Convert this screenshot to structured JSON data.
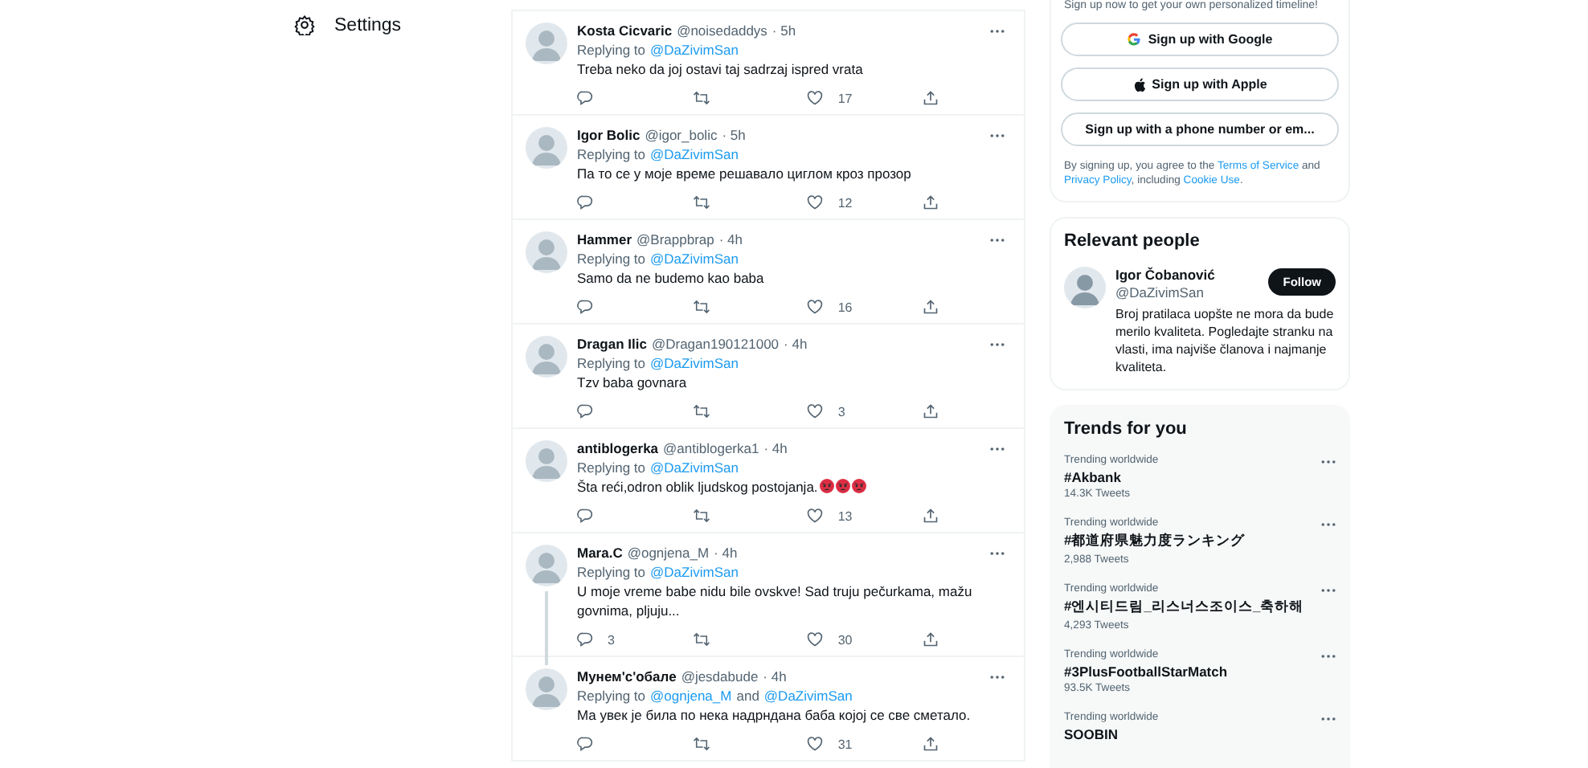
{
  "nav": {
    "settings_label": "Settings"
  },
  "tweets": [
    {
      "name": "Kosta Cicvaric",
      "handle": "@noisedaddys",
      "time": "· 5h",
      "replying_label": "Replying to",
      "replying_to": [
        "@DaZivimSan"
      ],
      "text": "Treba neko da joj ostavi taj sadrzaj ispred vrata",
      "like_count": "17",
      "thread": false
    },
    {
      "name": "Igor Bolic",
      "handle": "@igor_bolic",
      "time": "· 5h",
      "replying_label": "Replying to",
      "replying_to": [
        "@DaZivimSan"
      ],
      "text": "Па то се у моје време решавало циглом кроз прозор",
      "like_count": "12",
      "thread": false
    },
    {
      "name": "Hammer",
      "handle": "@Brappbrap",
      "time": "· 4h",
      "replying_label": "Replying to",
      "replying_to": [
        "@DaZivimSan"
      ],
      "text": "Samo da ne budemo kao baba",
      "like_count": "16",
      "thread": false
    },
    {
      "name": "Dragan Ilic",
      "handle": "@Dragan190121000",
      "time": "· 4h",
      "replying_label": "Replying to",
      "replying_to": [
        "@DaZivimSan"
      ],
      "text": "Tzv baba govnara",
      "like_count": "3",
      "thread": false
    },
    {
      "name": "antiblogerka",
      "handle": "@antiblogerka1",
      "time": "· 4h",
      "replying_label": "Replying to",
      "replying_to": [
        "@DaZivimSan"
      ],
      "text": "Šta reći,odron oblik ljudskog postojanja.",
      "angry_emojis": true,
      "like_count": "13",
      "thread": false
    },
    {
      "name": "Mara.C",
      "handle": "@ognjena_M",
      "time": "· 4h",
      "replying_label": "Replying to",
      "replying_to": [
        "@DaZivimSan"
      ],
      "text": "U moje vreme babe nidu bile ovskve! Sad truju pečurkama, mažu govnima, pljuju...",
      "reply_count": "3",
      "like_count": "30",
      "thread": true
    },
    {
      "name": "Мунем'с'обале",
      "handle": "@jesdabude",
      "time": "· 4h",
      "replying_label": "Replying to",
      "replying_to": [
        "@ognjena_M",
        "@DaZivimSan"
      ],
      "joiner": "and",
      "text": "Ма увек је била по нека надрндана баба којој се све сметало.",
      "like_count": "31",
      "thread": false
    }
  ],
  "signup": {
    "intro": "Sign up now to get your own personalized timeline!",
    "buttons": [
      {
        "kind": "google",
        "label": "Sign up with Google"
      },
      {
        "kind": "apple",
        "label": "Sign up with Apple"
      },
      {
        "kind": "plain",
        "label": "Sign up with a phone number or em..."
      }
    ],
    "terms": {
      "before": "By signing up, you agree to the",
      "tos": "Terms of Service",
      "and": "and",
      "privacy": "Privacy Policy",
      "including": ", including",
      "cookie": "Cookie Use",
      "end": "."
    }
  },
  "relevant": {
    "title": "Relevant people",
    "person": {
      "name": "Igor Čobanović",
      "handle": "@DaZivimSan",
      "bio": "Broj pratilaca uopšte ne mora da bude merilo kvaliteta. Pogledajte stranku na vlasti, ima najviše članova i najmanje kvaliteta.",
      "follow": "Follow"
    }
  },
  "trends": {
    "title": "Trends for you",
    "items": [
      {
        "context": "Trending worldwide",
        "topic": "#Akbank",
        "count": "14.3K Tweets"
      },
      {
        "context": "Trending worldwide",
        "topic": "#都道府県魅力度ランキング",
        "count": "2,988 Tweets"
      },
      {
        "context": "Trending worldwide",
        "topic": "#엔시티드림_리스너스조이스_축하해",
        "count": "4,293 Tweets"
      },
      {
        "context": "Trending worldwide",
        "topic": "#3PlusFootballStarMatch",
        "count": "93.5K Tweets"
      },
      {
        "context": "Trending worldwide",
        "topic": "SOOBIN"
      }
    ]
  }
}
